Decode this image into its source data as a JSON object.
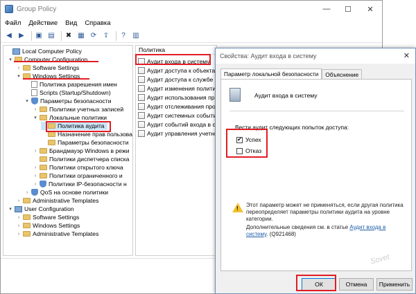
{
  "window": {
    "title": "Group Policy",
    "controls": {
      "minimize": "—",
      "maximize": "☐",
      "close": "✕"
    }
  },
  "menu": [
    "Файл",
    "Действие",
    "Вид",
    "Справка"
  ],
  "tree": {
    "root": "Local Computer Policy",
    "computer_config": "Computer Configuration",
    "software_settings": "Software Settings",
    "windows_settings": "Windows Settings",
    "name_resolution": "Политика разрешения имен",
    "scripts": "Scripts (Startup/Shutdown)",
    "security_settings": "Параметры безопасности",
    "account_policies": "Политики учетных записей",
    "local_policies": "Локальные политики",
    "audit_policy": "Политика аудита",
    "user_rights": "Назначение прав пользова",
    "security_options": "Параметры безопасности",
    "firewall": "Брандмауэр Windows в режи",
    "network_list": "Политики диспетчера списка",
    "public_key": "Политики открытого ключа",
    "software_restriction": "Политики ограниченного и",
    "ipsec": "Политики IP-безопасности н",
    "qos": "QoS на основе политики",
    "admin_templates": "Administrative Templates",
    "user_config": "User Configuration",
    "user_software": "Software Settings",
    "user_windows": "Windows Settings",
    "user_admin": "Administrative Templates"
  },
  "list": {
    "header": "Политика",
    "items": [
      "Аудит входа в систему",
      "Аудит доступа к объектам",
      "Аудит доступа к службе к",
      "Аудит изменения политик",
      "Аудит использования при",
      "Аудит отслеживания проц",
      "Аудит системных событий",
      "Аудит событий входа в си",
      "Аудит управления учетны"
    ]
  },
  "dialog": {
    "title": "Свойства: Аудит входа в систему",
    "close": "✕",
    "tabs": [
      "Параметр локальной безопасности",
      "Объяснение"
    ],
    "policy_name": "Аудит входа в систему",
    "audit_label": "Вести аудит следующих попыток доступа:",
    "success_label": "Успех",
    "success_checked": true,
    "failure_label": "Отказ",
    "failure_checked": false,
    "warning_text": "Этот параметр может не применяться, если другая политика переопределяет параметры политики аудита на уровне категории.",
    "more_info_prefix": "Дополнительные сведения см. в статье",
    "more_info_link": "Аудит входа в систему",
    "more_info_suffix": ". (Q921468)",
    "buttons": {
      "ok": "ОК",
      "cancel": "Отмена",
      "apply": "Применить"
    }
  },
  "watermark": "Sovet",
  "accent_color": "#e21b23"
}
